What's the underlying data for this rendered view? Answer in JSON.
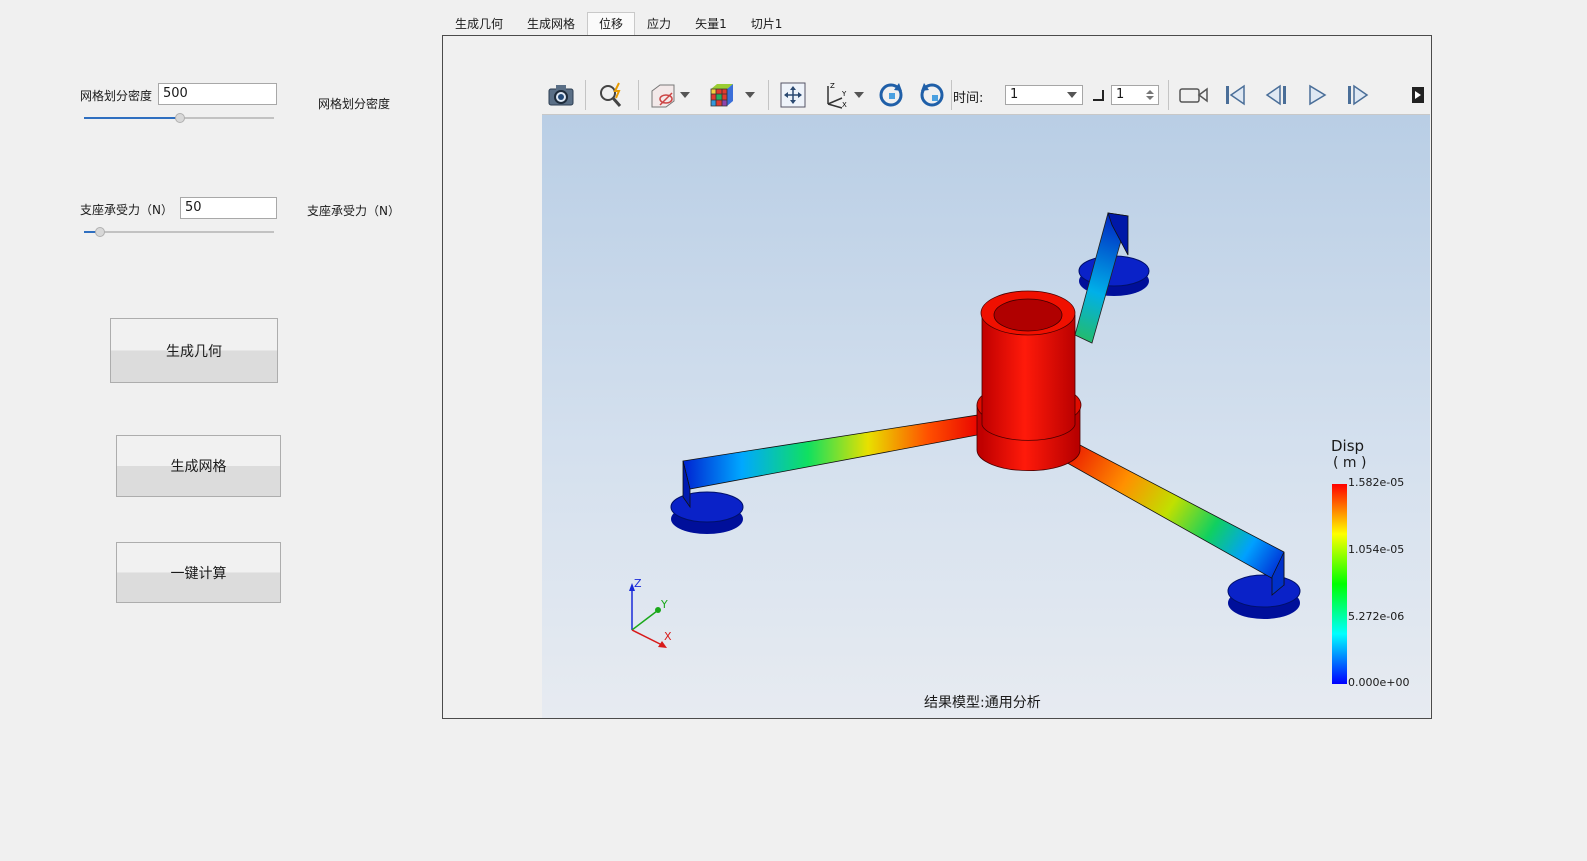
{
  "left_panel": {
    "mesh_density": {
      "label": "网格划分密度",
      "value": "500",
      "side_label": "网格划分密度",
      "slider_level": 0.5
    },
    "support_force": {
      "label": "支座承受力（N）",
      "value": "50",
      "side_label": "支座承受力（N）",
      "slider_level": 0.08
    },
    "buttons": {
      "generate_geometry": "生成几何",
      "generate_mesh": "生成网格",
      "one_click_compute": "一键计算"
    }
  },
  "tabs": [
    {
      "label": "生成几何",
      "active": false
    },
    {
      "label": "生成网格",
      "active": false
    },
    {
      "label": "位移",
      "active": true
    },
    {
      "label": "应力",
      "active": false
    },
    {
      "label": "矢量1",
      "active": false
    },
    {
      "label": "切片1",
      "active": false
    }
  ],
  "toolbar": {
    "time_label": "时间:",
    "time_value": "1",
    "step_value": "1",
    "icons": [
      "camera-icon",
      "zoom-icon",
      "display-mode-icon",
      "color-cube-icon",
      "fit-view-icon",
      "axes-icon",
      "rotate-cw-icon",
      "rotate-ccw-icon",
      "record-icon",
      "first-frame-icon",
      "prev-frame-icon",
      "play-icon",
      "next-frame-icon",
      "expand-icon"
    ]
  },
  "viewport": {
    "result_caption": "结果模型:通用分析",
    "triad": {
      "z": "Z",
      "y": "Y",
      "x": "X"
    },
    "legend": {
      "title_line1": "Disp",
      "title_line2": "( m )",
      "labels": [
        "1.582e-05",
        "1.054e-05",
        "5.272e-06",
        "0.000e+00"
      ],
      "colors": [
        "#ff0000",
        "#ffff00",
        "#00ff00",
        "#00ffff",
        "#0000ff"
      ]
    }
  }
}
